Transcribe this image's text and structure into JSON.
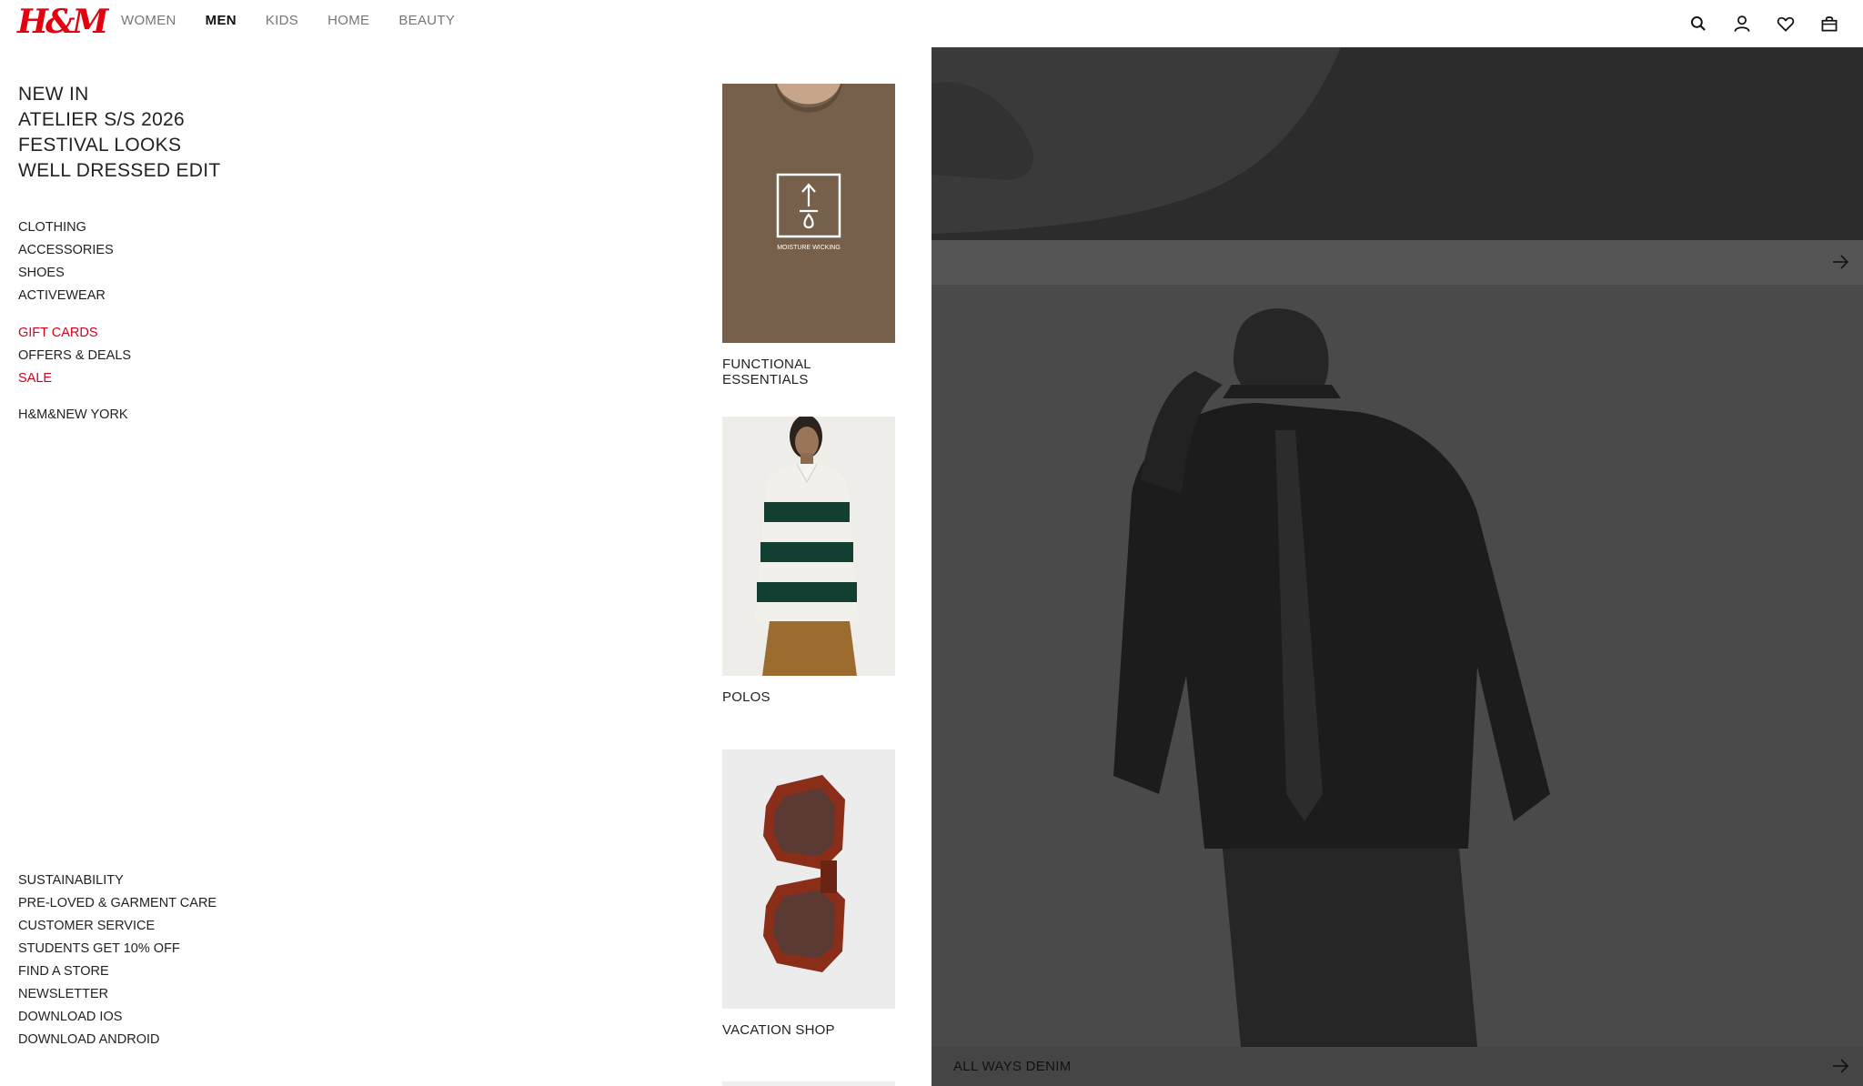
{
  "header": {
    "logo": "H&M",
    "nav": [
      "WOMEN",
      "MEN",
      "KIDS",
      "HOME",
      "BEAUTY"
    ],
    "active_nav": "MEN",
    "icons": [
      "search-icon",
      "account-icon",
      "favorites-icon",
      "bag-icon"
    ]
  },
  "menu": {
    "featured": [
      "NEW IN",
      "ATELIER S/S 2026",
      "FESTIVAL LOOKS",
      "WELL DRESSED EDIT"
    ],
    "categories": [
      "CLOTHING",
      "ACCESSORIES",
      "SHOES",
      "ACTIVEWEAR"
    ],
    "offers": [
      {
        "label": "GIFT CARDS",
        "highlight": true
      },
      {
        "label": "OFFERS & DEALS",
        "highlight": false
      },
      {
        "label": "SALE",
        "highlight": true
      }
    ],
    "collab": "H&M&NEW YORK",
    "footer_links": [
      "SUSTAINABILITY",
      "PRE-LOVED & GARMENT CARE",
      "CUSTOMER SERVICE",
      "STUDENTS GET 10% OFF",
      "FIND A STORE",
      "NEWSLETTER",
      "DOWNLOAD IOS",
      "DOWNLOAD ANDROID"
    ]
  },
  "products": [
    {
      "caption": "FUNCTIONAL ESSENTIALS",
      "badge": "MOISTURE WICKING"
    },
    {
      "caption": "POLOS"
    },
    {
      "caption": "VACATION SHOP"
    }
  ],
  "hero": {
    "caption": "ALL WAYS DENIM"
  },
  "colors": {
    "brand": "#e50010",
    "highlight_text": "#d6001c",
    "overlay": "#4c4c4c"
  }
}
